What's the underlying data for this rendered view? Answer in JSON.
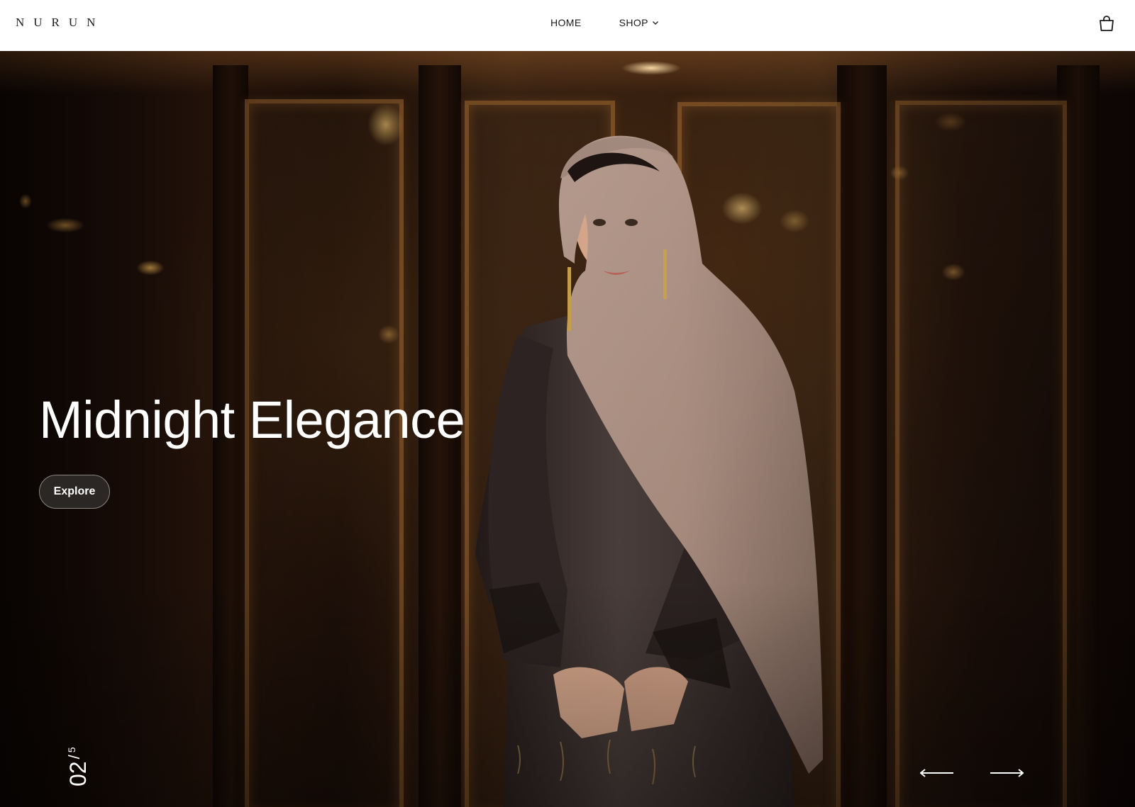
{
  "header": {
    "logo": "NURUN",
    "nav": [
      {
        "label": "HOME"
      },
      {
        "label": "SHOP"
      }
    ],
    "icons": {
      "shop_dropdown": "chevron-down-icon",
      "cart": "shopping-bag-icon"
    }
  },
  "hero": {
    "title": "Midnight Elegance",
    "cta_label": "Explore",
    "slide_current": "02",
    "slide_separator": "/",
    "slide_total": "5",
    "icons": {
      "prev": "arrow-left-icon",
      "next": "arrow-right-icon"
    }
  },
  "colors": {
    "header_bg": "#ffffff",
    "text_dark": "#1a1a1a",
    "hero_text": "#ffffff",
    "button_bg": "#2b2725",
    "hijab": "#9c8478",
    "abaya": "#3a302e"
  }
}
